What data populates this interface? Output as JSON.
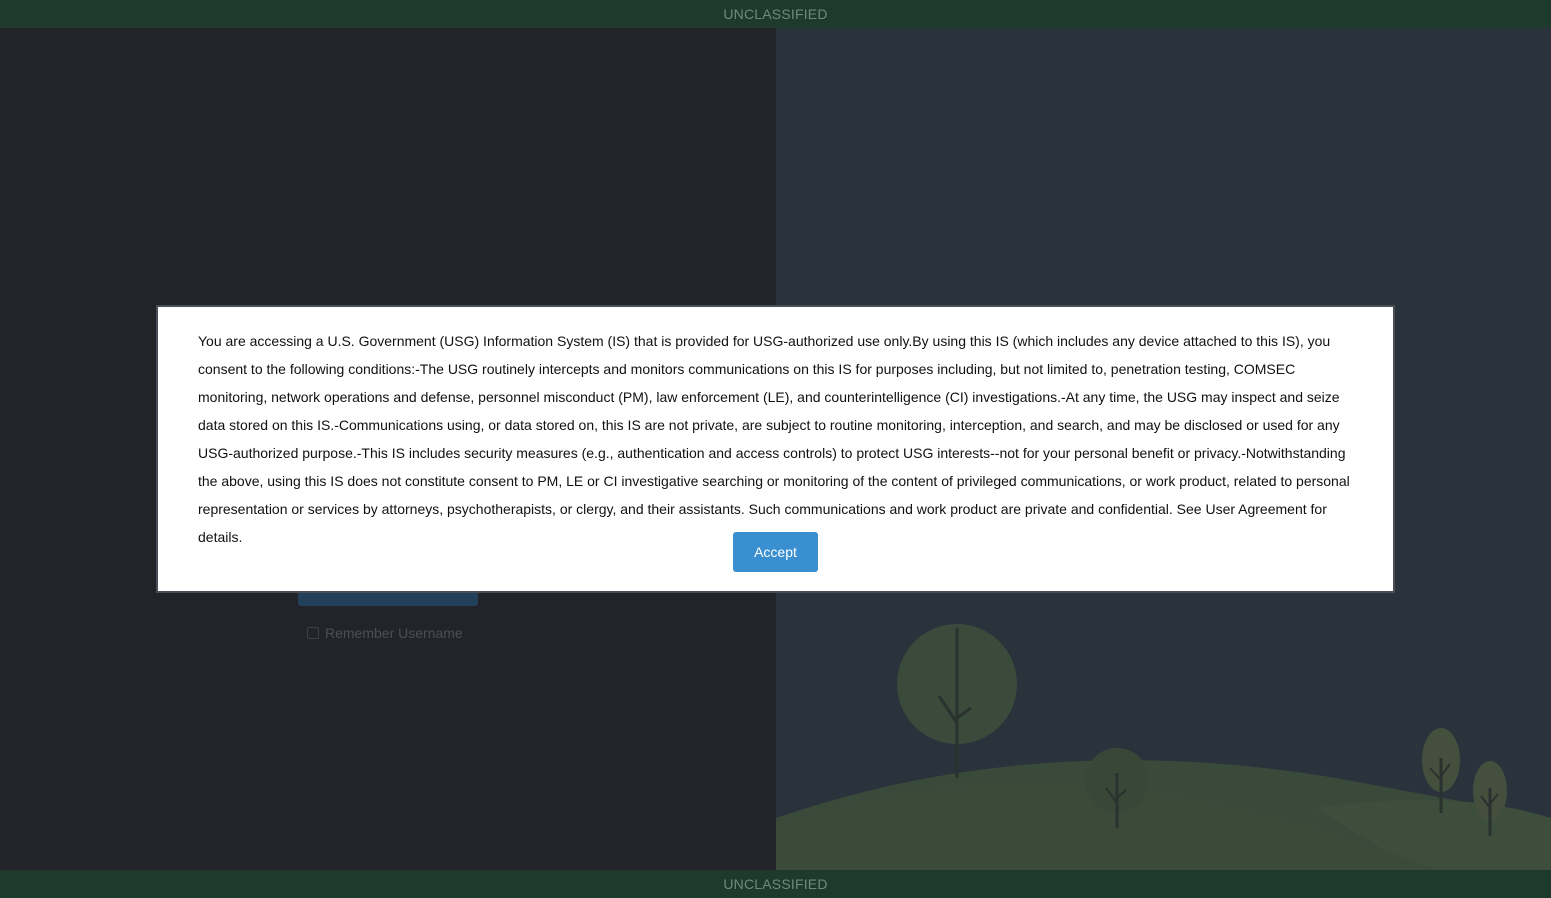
{
  "banner": {
    "top_label": "UNCLASSIFIED",
    "bottom_label": "UNCLASSIFIED",
    "color": "#1d3a2d"
  },
  "login": {
    "remember_label": "Remember Username",
    "remember_checked": false
  },
  "modal": {
    "consent_text": "You are accessing a U.S. Government (USG) Information System (IS) that is provided for USG-authorized use only.By using this IS (which includes any device attached to this IS), you consent to the following conditions:-The USG routinely intercepts and monitors communications on this IS for purposes including, but not limited to, penetration testing, COMSEC monitoring, network operations and defense, personnel misconduct (PM), law enforcement (LE), and counterintelligence (CI) investigations.-At any time, the USG may inspect and seize data stored on this IS.-Communications using, or data stored on, this IS are not private, are subject to routine monitoring, interception, and search, and may be disclosed or used for any USG-authorized purpose.-This IS includes security measures (e.g., authentication and access controls) to protect USG interests--not for your personal benefit or privacy.-Notwithstanding the above, using this IS does not constitute consent to PM, LE or CI investigative searching or monitoring of the content of privileged communications, or work product, related to personal representation or services by attorneys, psychotherapists, or clergy, and their assistants. Such communications and work product are private and confidential. See User Agreement for details.",
    "accept_label": "Accept",
    "accept_color": "#3a8fd0"
  }
}
